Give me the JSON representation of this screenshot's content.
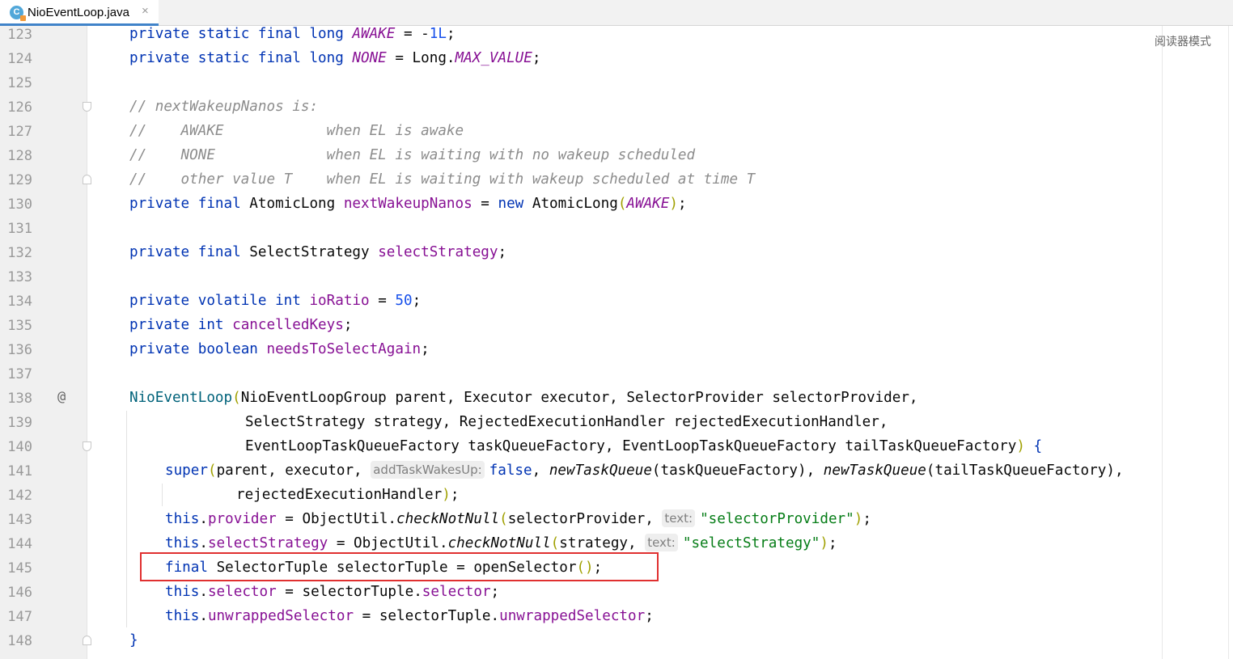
{
  "tab": {
    "icon_letter": "C",
    "filename": "NioEventLoop.java",
    "close": "×"
  },
  "reader_mode": "阅读器模式",
  "line_numbers": [
    "123",
    "124",
    "125",
    "126",
    "127",
    "128",
    "129",
    "130",
    "131",
    "132",
    "133",
    "134",
    "135",
    "136",
    "137",
    "138",
    "139",
    "140",
    "141",
    "142",
    "143",
    "144",
    "145",
    "146",
    "147",
    "148"
  ],
  "code": {
    "l123": {
      "kw": "private static final long ",
      "field": "AWAKE",
      "rest": " = -",
      "num": "1L",
      "end": ";"
    },
    "l124": {
      "kw": "private static final long ",
      "field": "NONE",
      "mid": " = Long.",
      "field2": "MAX_VALUE",
      "end": ";"
    },
    "l126": "// nextWakeupNanos is:",
    "l127": "//    AWAKE            when EL is awake",
    "l128": "//    NONE             when EL is waiting with no wakeup scheduled",
    "l129": "//    other value T    when EL is waiting with wakeup scheduled at time T",
    "l130": {
      "kw": "private final ",
      "type": "AtomicLong ",
      "field": "nextWakeupNanos",
      "mid": " = ",
      "kw2": "new ",
      "type2": "AtomicLong",
      "open": "(",
      "arg": "AWAKE",
      "close": ")",
      "end": ";"
    },
    "l132": {
      "kw": "private final ",
      "type": "SelectStrategy ",
      "field": "selectStrategy",
      "end": ";"
    },
    "l134": {
      "kw": "private volatile int ",
      "field": "ioRatio",
      "mid": " = ",
      "num": "50",
      "end": ";"
    },
    "l135": {
      "kw": "private int ",
      "field": "cancelledKeys",
      "end": ";"
    },
    "l136": {
      "kw": "private boolean ",
      "field": "needsToSelectAgain",
      "end": ";"
    },
    "l138": {
      "fn": "NioEventLoop",
      "open": "(",
      "rest": "NioEventLoopGroup parent, Executor executor, SelectorProvider selectorProvider,"
    },
    "l139": "SelectStrategy strategy, RejectedExecutionHandler rejectedExecutionHandler,",
    "l140": {
      "rest": "EventLoopTaskQueueFactory taskQueueFactory, EventLoopTaskQueueFactory tailTaskQueueFactory",
      "close": ")",
      "brace": " {"
    },
    "l141": {
      "kw": "super",
      "open": "(",
      "args": "parent, executor, ",
      "hint": "addTaskWakesUp:",
      "kw2": "false",
      "sep": ", ",
      "call1": "newTaskQueue",
      "arg1": "(taskQueueFactory)",
      "sep2": ", ",
      "call2": "newTaskQueue",
      "arg2": "(tailTaskQueueFactory)",
      "end": ","
    },
    "l142": {
      "rest": "rejectedExecutionHandler",
      "close": ")",
      "end": ";"
    },
    "l143": {
      "kw": "this",
      "dot": ".",
      "field": "provider",
      "mid": " = ObjectUtil.",
      "call": "checkNotNull",
      "open": "(",
      "args": "selectorProvider, ",
      "hint": "text:",
      "str": "\"selectorProvider\"",
      "close": ")",
      "end": ";"
    },
    "l144": {
      "kw": "this",
      "dot": ".",
      "field": "selectStrategy",
      "mid": " = ObjectUtil.",
      "call": "checkNotNull",
      "open": "(",
      "args": "strategy, ",
      "hint": "text:",
      "str": "\"selectStrategy\"",
      "close": ")",
      "end": ";"
    },
    "l145": {
      "kw": "final ",
      "rest": "SelectorTuple selectorTuple = openSelector",
      "parens": "()",
      "end": ";"
    },
    "l146": {
      "kw": "this",
      "dot": ".",
      "field": "selector",
      "mid": " = selectorTuple.",
      "field2": "selector",
      "end": ";"
    },
    "l147": {
      "kw": "this",
      "dot": ".",
      "field": "unwrappedSelector",
      "mid": " = selectorTuple.",
      "field2": "unwrappedSelector",
      "end": ";"
    },
    "l148": "}"
  },
  "gutter_markers": {
    "override_icon": "@"
  },
  "colors": {
    "keyword": "#0033b3",
    "field": "#871094",
    "number": "#1750eb",
    "string": "#067d17",
    "comment": "#8c8c8c",
    "highlight_box": "#e03030"
  }
}
